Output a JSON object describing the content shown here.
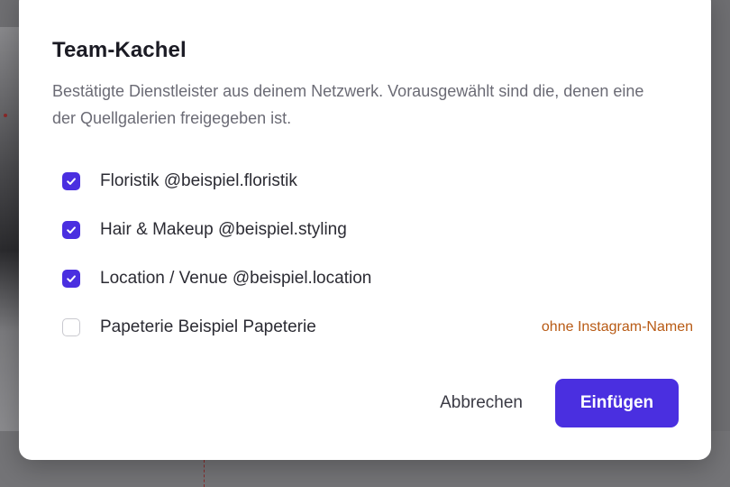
{
  "dialog": {
    "title": "Team-Kachel",
    "description": "Bestätigte Dienstleister aus deinem Netzwerk. Vorausgewählt sind die, denen eine der Quellgalerien freigegeben ist.",
    "vendors": [
      {
        "label": "Floristik @beispiel.floristik",
        "checked": true,
        "note": ""
      },
      {
        "label": "Hair & Makeup @beispiel.styling",
        "checked": true,
        "note": ""
      },
      {
        "label": "Location / Venue @beispiel.location",
        "checked": true,
        "note": ""
      },
      {
        "label": "Papeterie Beispiel Papeterie",
        "checked": false,
        "note": "ohne Instagram-Namen"
      }
    ],
    "cancel_label": "Abbrechen",
    "confirm_label": "Einfügen"
  },
  "colors": {
    "accent": "#4a2fe0",
    "warning_text": "#b85a14",
    "title_text": "#1b1b24",
    "muted_text": "#6b6b75"
  },
  "icons": {
    "checked": "checkmark-icon"
  }
}
